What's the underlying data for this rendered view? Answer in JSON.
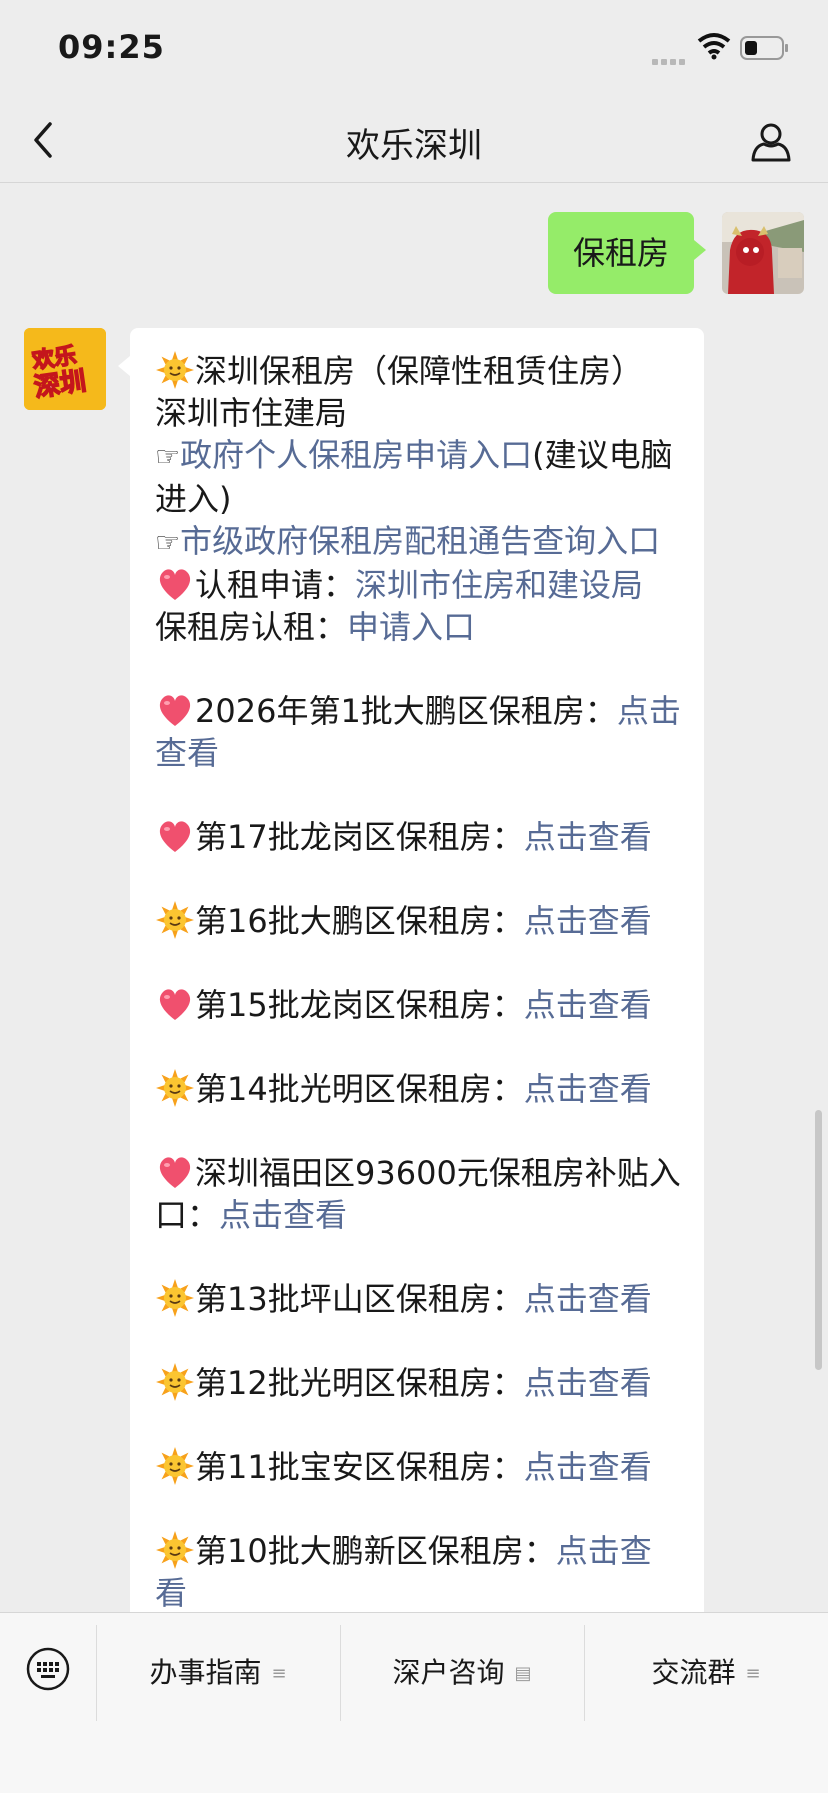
{
  "status_bar": {
    "time": "09:25"
  },
  "nav": {
    "title": "欢乐深圳"
  },
  "chat": {
    "my_message": "保租房",
    "bot_avatar_text": "欢乐深圳",
    "lines": [
      {
        "emoji": "sun",
        "text": "深圳保租房（保障性租赁住房）"
      },
      {
        "text": "深圳市住建局"
      },
      {
        "pointer": "☞",
        "link": "政府个人保租房申请入口",
        "text_after": "(建议电脑进入)"
      },
      {
        "pointer": "☞",
        "link": "市级政府保租房配租通告查询入口"
      },
      {
        "emoji": "heart",
        "text": "认租申请：",
        "link": "深圳市住房和建设局"
      },
      {
        "text": "保租房认租：",
        "link": "申请入口"
      },
      {
        "gap": true
      },
      {
        "emoji": "heart",
        "text": "2026年第1批大鹏区保租房：",
        "link": "点击查看"
      },
      {
        "gap": true
      },
      {
        "emoji": "heart",
        "text": "第17批龙岗区保租房：",
        "link": "点击查看"
      },
      {
        "gap": true
      },
      {
        "emoji": "sun",
        "text": "第16批大鹏区保租房：",
        "link": "点击查看"
      },
      {
        "gap": true
      },
      {
        "emoji": "heart",
        "text": "第15批龙岗区保租房：",
        "link": "点击查看"
      },
      {
        "gap": true
      },
      {
        "emoji": "sun",
        "text": "第14批光明区保租房：",
        "link": "点击查看"
      },
      {
        "gap": true
      },
      {
        "emoji": "heart",
        "text": "深圳福田区93600元保租房补贴入口：",
        "link": "点击查看"
      },
      {
        "gap": true
      },
      {
        "emoji": "sun",
        "text": "第13批坪山区保租房：",
        "link": "点击查看"
      },
      {
        "gap": true
      },
      {
        "emoji": "sun",
        "text": "第12批光明区保租房：",
        "link": "点击查看"
      },
      {
        "gap": true
      },
      {
        "emoji": "sun",
        "text": "第11批宝安区保租房：",
        "link": "点击查看"
      },
      {
        "gap": true
      },
      {
        "emoji": "sun",
        "text": "第10批大鹏新区保租房：",
        "link": "点击查看"
      }
    ]
  },
  "menu": {
    "items": [
      {
        "label": "办事指南",
        "icon": "≡"
      },
      {
        "label": "深户咨询",
        "icon": "▤"
      },
      {
        "label": "交流群",
        "icon": "≡"
      }
    ]
  }
}
